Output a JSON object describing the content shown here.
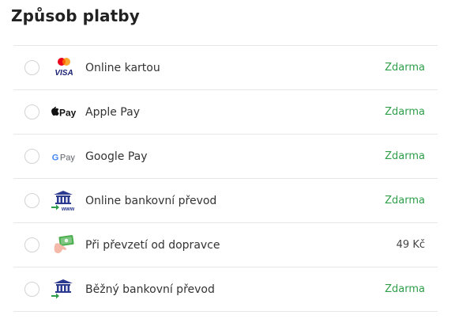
{
  "title": "Způsob platby",
  "methods": [
    {
      "label": "Online kartou",
      "price": "Zdarma",
      "icon": "visa-mastercard-icon",
      "selected": false
    },
    {
      "label": "Apple Pay",
      "price": "Zdarma",
      "icon": "apple-pay-icon",
      "selected": false
    },
    {
      "label": "Google Pay",
      "price": "Zdarma",
      "icon": "google-pay-icon",
      "selected": false
    },
    {
      "label": "Online bankovní převod",
      "price": "Zdarma",
      "icon": "bank-transfer-www-icon",
      "selected": false
    },
    {
      "label": "Při převzetí od dopravce",
      "price": "49 Kč",
      "icon": "cash-on-delivery-icon",
      "selected": false
    },
    {
      "label": "Běžný bankovní převod",
      "price": "Zdarma",
      "icon": "bank-transfer-icon",
      "selected": false
    }
  ],
  "colors": {
    "free": "#2e9e4a",
    "border": "#e6e6e6"
  },
  "icon_text": {
    "visa": "VISA",
    "apple_pay": "Pay",
    "google_pay_g": "G",
    "google_pay": "Pay",
    "www": "www"
  }
}
